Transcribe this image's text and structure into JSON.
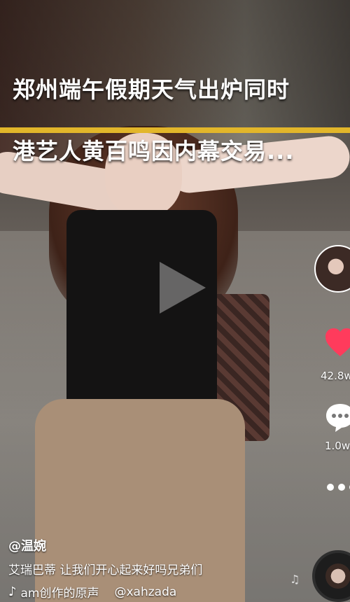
{
  "headline": {
    "line1": "郑州端午假期天气出炉同时",
    "line2": "港艺人黄百鸣因内幕交易..."
  },
  "rail": {
    "like_count": "42.8w",
    "comment_count": "1.0w"
  },
  "caption": {
    "author": "@温婉",
    "text": "艾瑞巴蒂 让我们开心起来好吗兄弟们",
    "music": "am创作的原声",
    "handle": "@xahzada"
  },
  "icons": {
    "play": "play-icon",
    "like": "heart-icon",
    "comment": "comment-icon",
    "more": "more-icon",
    "music": "music-note-icon",
    "disc": "music-disc-icon"
  },
  "colors": {
    "accent_bar": "#e2b62a",
    "like": "#ff3b5c"
  }
}
